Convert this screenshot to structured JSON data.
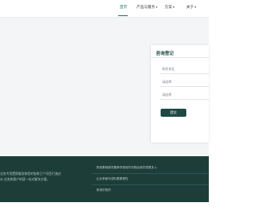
{
  "nav": {
    "items": [
      {
        "label": "首页",
        "active": true,
        "has_dropdown": false
      },
      {
        "label": "产品与服务",
        "active": false,
        "has_dropdown": true
      },
      {
        "label": "方案",
        "active": false,
        "has_dropdown": true
      },
      {
        "label": "关于",
        "active": false,
        "has_dropdown": true
      }
    ],
    "chevron": "▾"
  },
  "consult_form": {
    "title": "咨询登记",
    "fields": [
      {
        "placeholder": "联系电话"
      },
      {
        "placeholder": "请选择"
      },
      {
        "placeholder": "请选择"
      }
    ],
    "submit_label": "提交"
  },
  "footer": {
    "left_text_line1": "业务专项置换服务和您的协和已个项目打造应",
    "left_text_line2": "水,业务和客户的获一站式解决方案。",
    "links": [
      "常用基础服务置事项使用的流程运用的规更多入",
      "企业养输写成料着着理性",
      "常用的笔的"
    ]
  },
  "colors": {
    "accent": "#1f6f62",
    "footer_bg": "#1d3d38",
    "button_bg": "#1f4a44"
  }
}
